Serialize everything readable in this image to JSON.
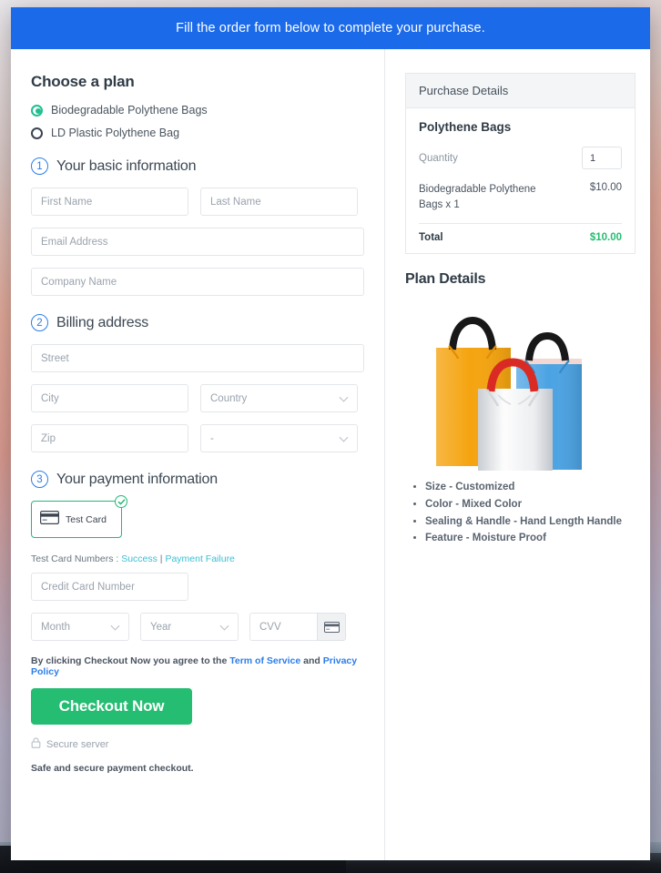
{
  "banner": {
    "text": "Fill the order form below to complete your purchase."
  },
  "plan": {
    "heading": "Choose a plan",
    "options": [
      {
        "label": "Biodegradable Polythene Bags",
        "selected": true
      },
      {
        "label": "LD Plastic Polythene Bag",
        "selected": false
      }
    ]
  },
  "steps": {
    "basic": {
      "number": "1",
      "title": "Your basic information"
    },
    "billing": {
      "number": "2",
      "title": "Billing address"
    },
    "payment": {
      "number": "3",
      "title": "Your payment information"
    }
  },
  "basic_fields": {
    "first_name": {
      "placeholder": "First Name",
      "value": ""
    },
    "last_name": {
      "placeholder": "Last Name",
      "value": ""
    },
    "email": {
      "placeholder": "Email Address",
      "value": ""
    },
    "company": {
      "placeholder": "Company Name",
      "value": ""
    }
  },
  "billing_fields": {
    "street": {
      "placeholder": "Street",
      "value": ""
    },
    "city": {
      "placeholder": "City",
      "value": ""
    },
    "country": {
      "placeholder": "Country",
      "value": ""
    },
    "zip": {
      "placeholder": "Zip",
      "value": ""
    },
    "state": {
      "placeholder": "-",
      "value": ""
    }
  },
  "payment": {
    "test_card_label": "Test  Card",
    "test_card_icon": "credit-card-icon",
    "check_badge_icon": "check-circle-icon",
    "test_numbers_prefix": "Test Card Numbers : ",
    "test_success_link": "Success",
    "test_separator": " | ",
    "test_failure_link": "Payment Failure",
    "card_number": {
      "placeholder": "Credit Card Number",
      "value": ""
    },
    "month": {
      "placeholder": "Month",
      "value": ""
    },
    "year": {
      "placeholder": "Year",
      "value": ""
    },
    "cvv": {
      "placeholder": "CVV",
      "value": ""
    },
    "cvv_icon": "credit-card-icon"
  },
  "footer": {
    "terms_prefix": "By clicking Checkout Now you agree to the ",
    "terms_link": "Term of Service",
    "terms_middle": " and ",
    "privacy_link": "Privacy Policy",
    "checkout_label": "Checkout Now",
    "secure_icon": "lock-icon",
    "secure_label": "Secure server",
    "safe_note": "Safe and secure payment checkout."
  },
  "purchase_details": {
    "header": "Purchase Details",
    "product_title": "Polythene Bags",
    "quantity_label": "Quantity",
    "quantity_value": "1",
    "line_item_name": "Biodegradable Polythene Bags x 1",
    "line_item_price": "$10.00",
    "total_label": "Total",
    "total_value": "$10.00"
  },
  "plan_details": {
    "heading": "Plan Details",
    "image_alt": "polythene-bags-image",
    "features": [
      "Size - Customized",
      "Color - Mixed Color",
      "Sealing & Handle - Hand Length Handle",
      "Feature - Moisture Proof"
    ]
  },
  "colors": {
    "banner_blue": "#1a6aea",
    "accent_green": "#25bd72",
    "radio_green": "#1fbf8f",
    "link_blue": "#2b7de9",
    "link_teal": "#3bbfd4",
    "step_blue": "#2b7de9"
  }
}
